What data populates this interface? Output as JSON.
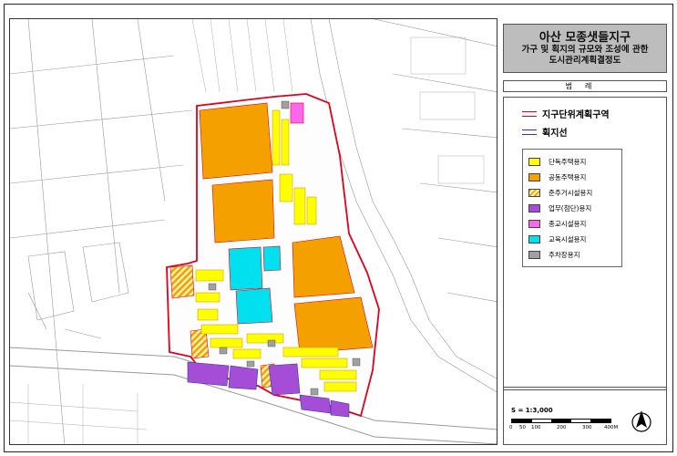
{
  "title": {
    "line1": "아산 모종샛들지구",
    "line2": "가구 및 획지의 규모와 조성에 관한",
    "line3": "도시관리계획결정도"
  },
  "legend": {
    "heading": "범례",
    "lines": [
      {
        "label": "지구단위계획구역",
        "color": "#e0001b"
      },
      {
        "label": "획지선",
        "color": "#3333aa"
      }
    ],
    "items": [
      {
        "label": "단독주택용지",
        "color": "#ffff00",
        "pattern": "solid"
      },
      {
        "label": "공동주택용지",
        "color": "#f4a100",
        "pattern": "solid"
      },
      {
        "label": "준주거시설용지",
        "color": "#f4a100",
        "pattern": "hatch"
      },
      {
        "label": "업무(첨단)용지",
        "color": "#a64dd8",
        "pattern": "solid"
      },
      {
        "label": "종교시설용지",
        "color": "#ff66ee",
        "pattern": "solid"
      },
      {
        "label": "교육시설용지",
        "color": "#00e0ee",
        "pattern": "solid"
      },
      {
        "label": "주차장용지",
        "color": "#a0a0a0",
        "pattern": "solid"
      }
    ]
  },
  "scale": {
    "label": "S = 1:3,000",
    "ticks": [
      "0",
      "50",
      "100",
      "200",
      "300",
      "400M"
    ],
    "north_icon": "north-arrow-icon"
  },
  "colors": {
    "boundary": "#e0001b",
    "lot_line": "#3333aa",
    "apartment": "#f4a100",
    "detached": "#ffff00",
    "business": "#a64dd8",
    "religion": "#ff66ee",
    "education": "#00e0ee",
    "parking": "#a0a0a0",
    "basemap": "#888888"
  }
}
